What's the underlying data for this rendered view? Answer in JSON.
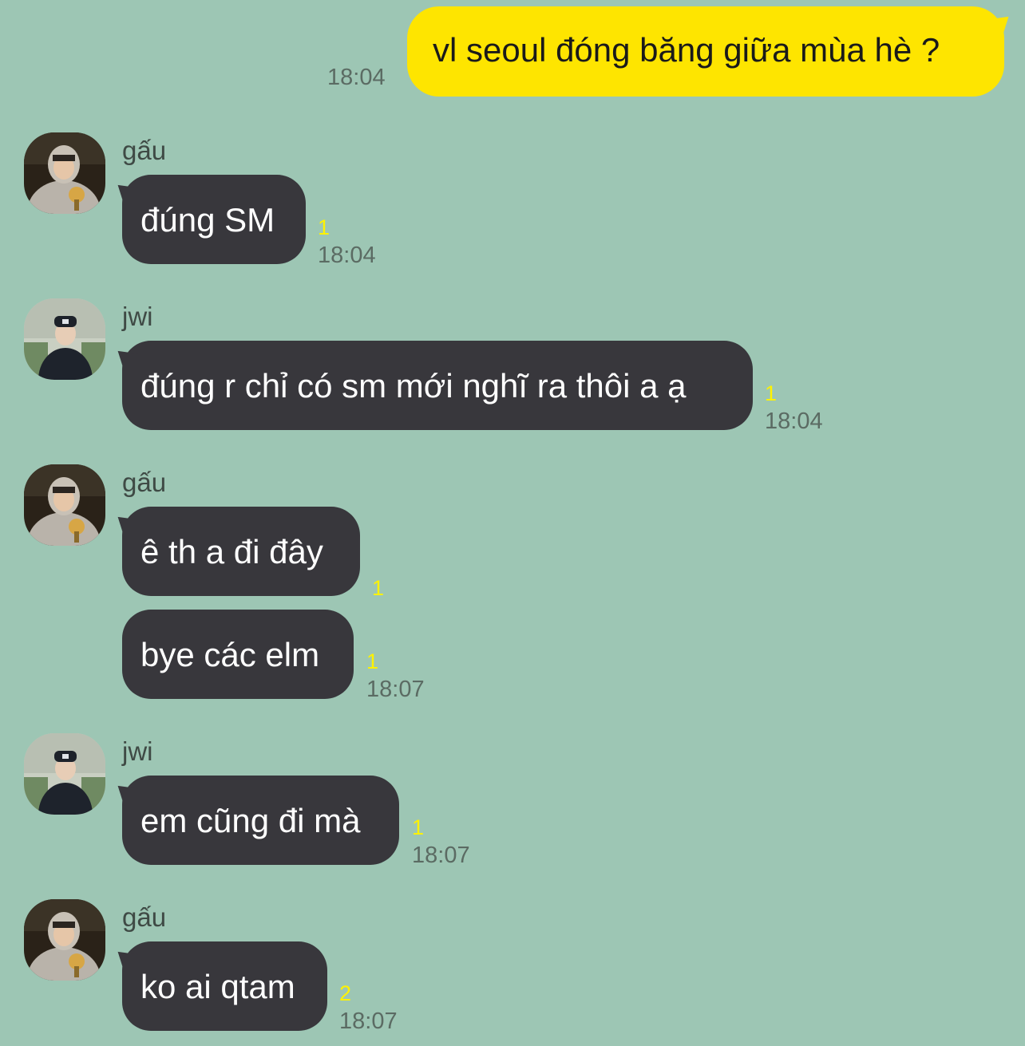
{
  "messages": [
    {
      "id": "m1",
      "direction": "out",
      "text": "vl seoul đóng băng giữa mùa hè ?",
      "time": "18:04"
    },
    {
      "id": "m2",
      "direction": "in",
      "sender": "gấu",
      "text": "đúng SM",
      "unread": "1",
      "time": "18:04"
    },
    {
      "id": "m3",
      "direction": "in",
      "sender": "jwi",
      "text": "đúng r chỉ có sm mới nghĩ ra thôi a ạ",
      "unread": "1",
      "time": "18:04"
    },
    {
      "id": "m4",
      "direction": "in",
      "sender": "gấu",
      "text": "ê th a đi đây",
      "unread": "1"
    },
    {
      "id": "m5",
      "direction": "in",
      "text": "bye các elm",
      "unread": "1",
      "time": "18:07"
    },
    {
      "id": "m6",
      "direction": "in",
      "sender": "jwi",
      "text": "em cũng đi mà",
      "unread": "1",
      "time": "18:07"
    },
    {
      "id": "m7",
      "direction": "in",
      "sender": "gấu",
      "text": "ko ai qtam",
      "unread": "2",
      "time": "18:07"
    }
  ],
  "colors": {
    "background": "#9dc6b4",
    "outgoing_bubble": "#fee500",
    "incoming_bubble": "#38373c",
    "unread_count": "#fff200"
  },
  "icons": {
    "avatar_gau": "user-avatar-photo",
    "avatar_jwi": "user-avatar-photo"
  }
}
